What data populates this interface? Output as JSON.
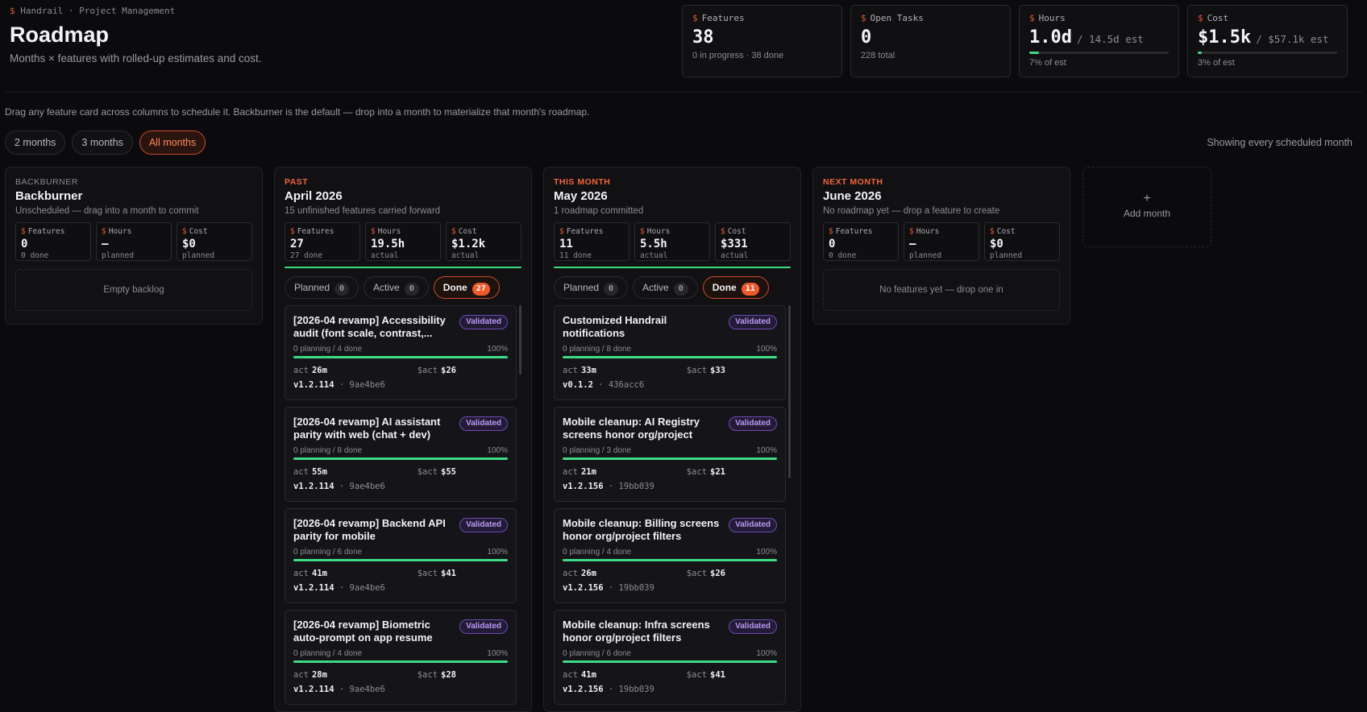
{
  "header": {
    "breadcrumb": "Handrail · Project Management",
    "title": "Roadmap",
    "subtitle": "Months × features with rolled-up estimates and cost."
  },
  "kpis": [
    {
      "label": "Features",
      "value": "38",
      "est": "",
      "sub": "0 in progress · 38 done",
      "progress": null
    },
    {
      "label": "Open Tasks",
      "value": "0",
      "est": "",
      "sub": "228 total",
      "progress": null
    },
    {
      "label": "Hours",
      "value": "1.0d",
      "est": "/ 14.5d est",
      "sub": "7% of est",
      "progress": 0.07
    },
    {
      "label": "Cost",
      "value": "$1.5k",
      "est": "/ $57.1k est",
      "sub": "3% of est",
      "progress": 0.03
    }
  ],
  "hint": "Drag any feature card across columns to schedule it. Backburner is the default — drop into a month to materialize that month's roadmap.",
  "filters": [
    "2 months",
    "3 months",
    "All months"
  ],
  "filter_active": "All months",
  "showing": "Showing every scheduled month",
  "columns": [
    {
      "kicker": "BACKBURNER",
      "title": "Backburner",
      "sub": "Unscheduled — drag into a month to commit",
      "stats": [
        {
          "label": "Features",
          "value": "0",
          "sub": "0 done"
        },
        {
          "label": "Hours",
          "value": "—",
          "sub": "planned"
        },
        {
          "label": "Cost",
          "value": "$0",
          "sub": "planned"
        }
      ],
      "empty": "Empty backlog"
    },
    {
      "kicker": "PAST",
      "title": "April 2026",
      "sub": "15 unfinished features carried forward",
      "stats": [
        {
          "label": "Features",
          "value": "27",
          "sub": "27 done"
        },
        {
          "label": "Hours",
          "value": "19.5h",
          "sub": "actual"
        },
        {
          "label": "Cost",
          "value": "$1.2k",
          "sub": "actual"
        }
      ],
      "tabs": [
        {
          "label": "Planned",
          "count": "0"
        },
        {
          "label": "Active",
          "count": "0"
        },
        {
          "label": "Done",
          "count": "27"
        }
      ],
      "cards": [
        {
          "title": "[2026-04 revamp] Accessibility audit (font scale, contrast,...",
          "badge": "Validated",
          "planning": "0 planning / 4 done",
          "pct": "100%",
          "act_lbl": "act",
          "act": "26m",
          "cost_lbl": "$act",
          "cost": "$26",
          "version": "v1.2.114",
          "hash": "9ae4be6"
        },
        {
          "title": "[2026-04 revamp] AI assistant parity with web (chat + dev)",
          "badge": "Validated",
          "planning": "0 planning / 8 done",
          "pct": "100%",
          "act_lbl": "act",
          "act": "55m",
          "cost_lbl": "$act",
          "cost": "$55",
          "version": "v1.2.114",
          "hash": "9ae4be6"
        },
        {
          "title": "[2026-04 revamp] Backend API parity for mobile",
          "badge": "Validated",
          "planning": "0 planning / 6 done",
          "pct": "100%",
          "act_lbl": "act",
          "act": "41m",
          "cost_lbl": "$act",
          "cost": "$41",
          "version": "v1.2.114",
          "hash": "9ae4be6"
        },
        {
          "title": "[2026-04 revamp] Biometric auto-prompt on app resume",
          "badge": "Validated",
          "planning": "0 planning / 4 done",
          "pct": "100%",
          "act_lbl": "act",
          "act": "28m",
          "cost_lbl": "$act",
          "cost": "$28",
          "version": "v1.2.114",
          "hash": "9ae4be6"
        }
      ]
    },
    {
      "kicker": "THIS MONTH",
      "title": "May 2026",
      "sub": "1 roadmap committed",
      "stats": [
        {
          "label": "Features",
          "value": "11",
          "sub": "11 done"
        },
        {
          "label": "Hours",
          "value": "5.5h",
          "sub": "actual"
        },
        {
          "label": "Cost",
          "value": "$331",
          "sub": "actual"
        }
      ],
      "tabs": [
        {
          "label": "Planned",
          "count": "0"
        },
        {
          "label": "Active",
          "count": "0"
        },
        {
          "label": "Done",
          "count": "11"
        }
      ],
      "cards": [
        {
          "title": "Customized Handrail notifications",
          "badge": "Validated",
          "planning": "0 planning / 8 done",
          "pct": "100%",
          "act_lbl": "act",
          "act": "33m",
          "cost_lbl": "$act",
          "cost": "$33",
          "version": "v0.1.2",
          "hash": "436acc6"
        },
        {
          "title": "Mobile cleanup: AI Registry screens honor org/project filters",
          "badge": "Validated",
          "planning": "0 planning / 3 done",
          "pct": "100%",
          "act_lbl": "act",
          "act": "21m",
          "cost_lbl": "$act",
          "cost": "$21",
          "version": "v1.2.156",
          "hash": "19bb039"
        },
        {
          "title": "Mobile cleanup: Billing screens honor org/project filters",
          "badge": "Validated",
          "planning": "0 planning / 4 done",
          "pct": "100%",
          "act_lbl": "act",
          "act": "26m",
          "cost_lbl": "$act",
          "cost": "$26",
          "version": "v1.2.156",
          "hash": "19bb039"
        },
        {
          "title": "Mobile cleanup: Infra screens honor org/project filters",
          "badge": "Validated",
          "planning": "0 planning / 6 done",
          "pct": "100%",
          "act_lbl": "act",
          "act": "41m",
          "cost_lbl": "$act",
          "cost": "$41",
          "version": "v1.2.156",
          "hash": "19bb039"
        }
      ]
    },
    {
      "kicker": "NEXT MONTH",
      "title": "June 2026",
      "sub": "No roadmap yet — drop a feature to create",
      "stats": [
        {
          "label": "Features",
          "value": "0",
          "sub": "0 done"
        },
        {
          "label": "Hours",
          "value": "—",
          "sub": "planned"
        },
        {
          "label": "Cost",
          "value": "$0",
          "sub": "planned"
        }
      ],
      "empty": "No features yet — drop one in"
    }
  ],
  "add_month": {
    "plus": "+",
    "label": "Add month"
  },
  "colors": {
    "accent": "#e5582f",
    "success": "#3ddc84",
    "validated": "#b99af5"
  }
}
